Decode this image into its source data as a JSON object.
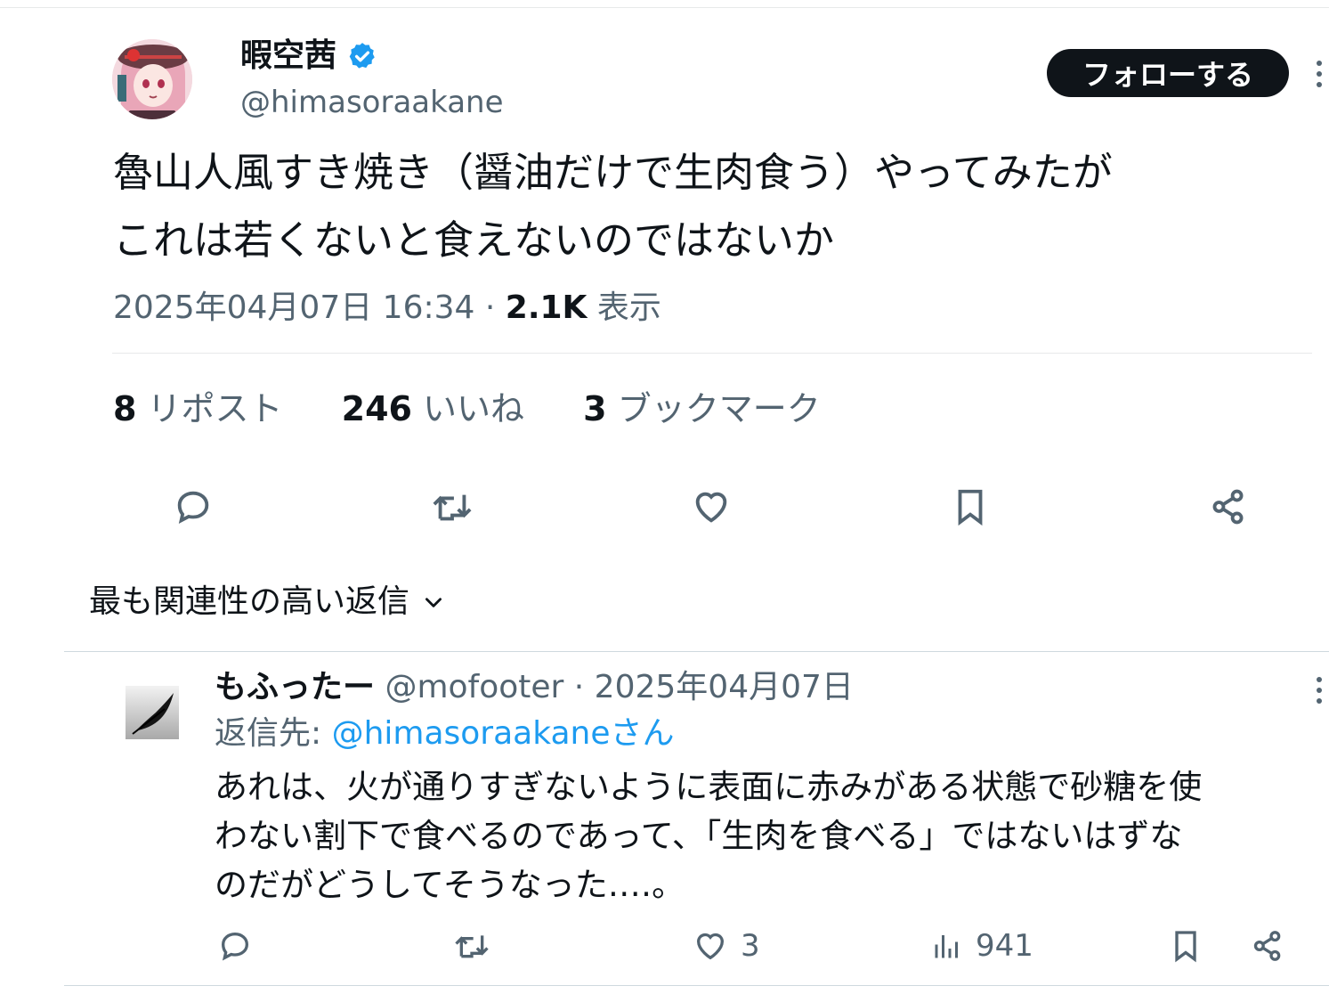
{
  "tweet": {
    "author_name": "暇空茜",
    "author_handle": "@himasoraakane",
    "follow_label": "フォローする",
    "text": "魯山人風すき焼き（醤油だけで生肉食う）やってみたが\nこれは若くないと食えないのではないか",
    "timestamp": "2025年04月07日 16:34",
    "separator": " · ",
    "views_count": "2.1K",
    "views_label": " 表示",
    "stats": {
      "reposts_count": "8",
      "reposts_label": " リポスト",
      "likes_count": "246",
      "likes_label": " いいね",
      "bookmarks_count": "3",
      "bookmarks_label": " ブックマーク"
    },
    "actions": [
      "reply-icon",
      "repost-icon",
      "like-icon",
      "bookmark-icon",
      "share-icon"
    ]
  },
  "replies_sort": {
    "label": "最も関連性の高い返信"
  },
  "reply": {
    "author_name": "もふったー",
    "author_handle": " @mofooter",
    "date": " · 2025年04月07日",
    "reply_to_prefix": "返信先: ",
    "reply_to_handle": "@himasoraakaneさん",
    "text": "あれは、火が通りすぎないように表面に赤みがある状態で砂糖を使\nわない割下で食べるのであって、「生肉を食べる」ではないはずな\nのだがどうしてそうなった‥‥。",
    "likes": "3",
    "views": "941"
  },
  "colors": {
    "accent": "#1d9bf0",
    "text": "#0f1419",
    "muted": "#536471",
    "border": "#e7e9ea"
  }
}
